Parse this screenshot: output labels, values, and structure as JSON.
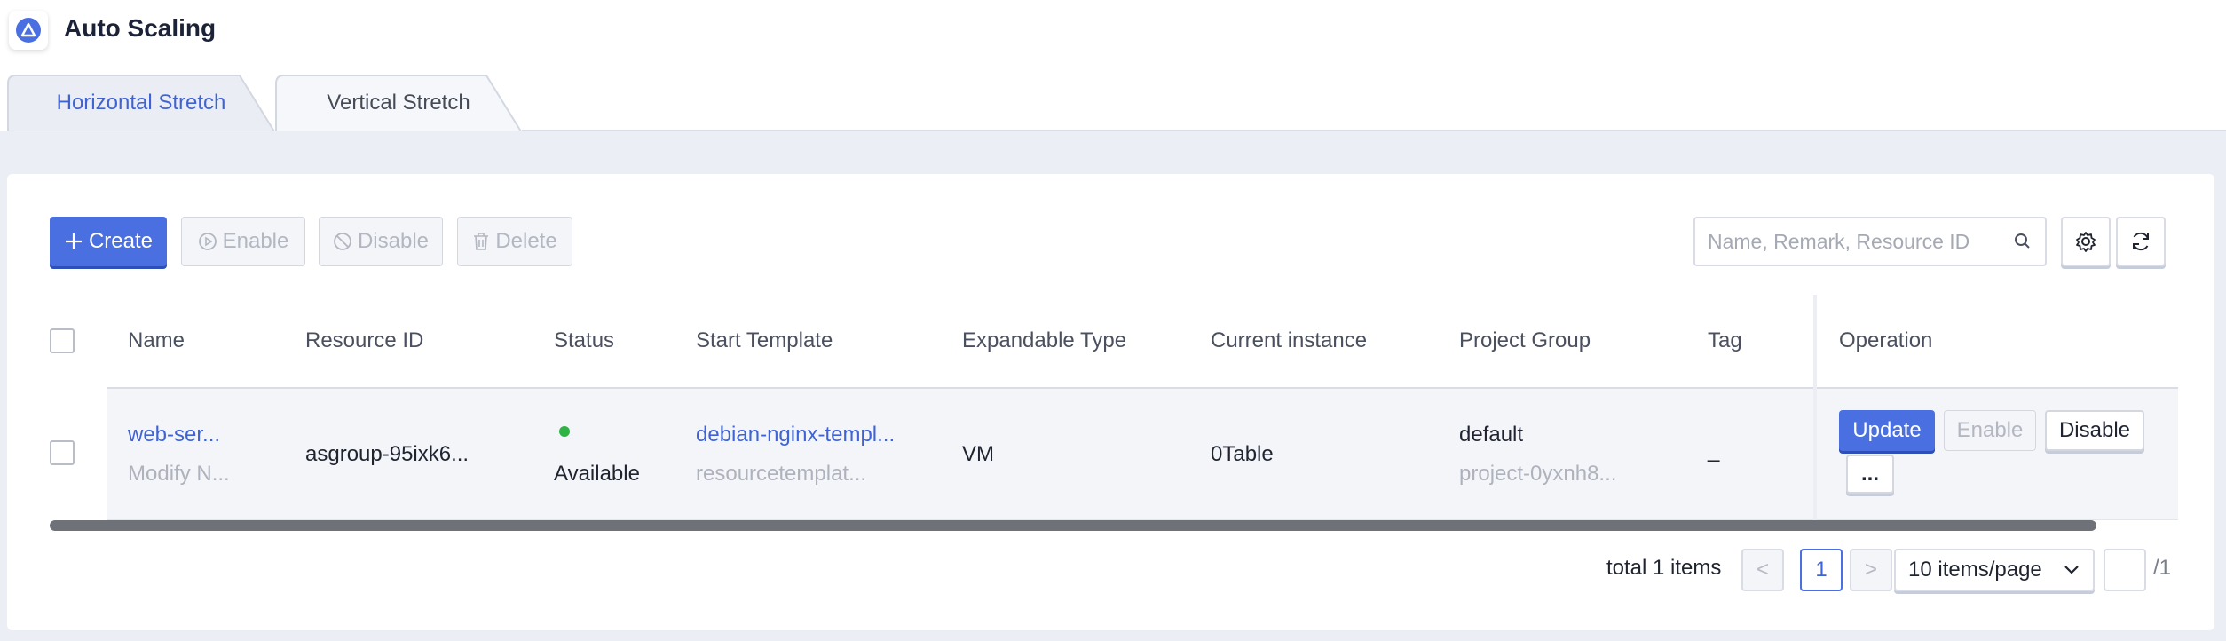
{
  "app": {
    "title": "Auto Scaling",
    "logo_icon": "scaling-logo-icon"
  },
  "tabs": [
    {
      "label": "Horizontal Stretch",
      "active": true
    },
    {
      "label": "Vertical Stretch",
      "active": false
    }
  ],
  "toolbar": {
    "create_label": "Create",
    "enable_label": "Enable",
    "disable_label": "Disable",
    "delete_label": "Delete",
    "search_placeholder": "Name, Remark, Resource ID",
    "accent_color": "#4a6fe0"
  },
  "table": {
    "columns": [
      "Name",
      "Resource ID",
      "Status",
      "Start Template",
      "Expandable Type",
      "Current instance",
      "Project Group",
      "Tag",
      "Operation"
    ],
    "rows": [
      {
        "name": "web-ser...",
        "remark": "Modify N...",
        "resource_id": "asgroup-95ixk6...",
        "status": "Available",
        "status_color": "#2fb344",
        "template": "debian-nginx-templ...",
        "template_id": "resourcetemplat...",
        "expandable_type": "VM",
        "current_instance": "0Table",
        "project_group": "default",
        "project_id": "project-0yxnh8...",
        "tag": "_",
        "ops": {
          "update": "Update",
          "enable": "Enable",
          "disable": "Disable",
          "more": "..."
        }
      }
    ]
  },
  "pagination": {
    "total_text": "total 1 items",
    "prev": "<",
    "current_page": "1",
    "next": ">",
    "page_size": "10 items/page",
    "goto_value": "",
    "of_pages": "/1"
  }
}
